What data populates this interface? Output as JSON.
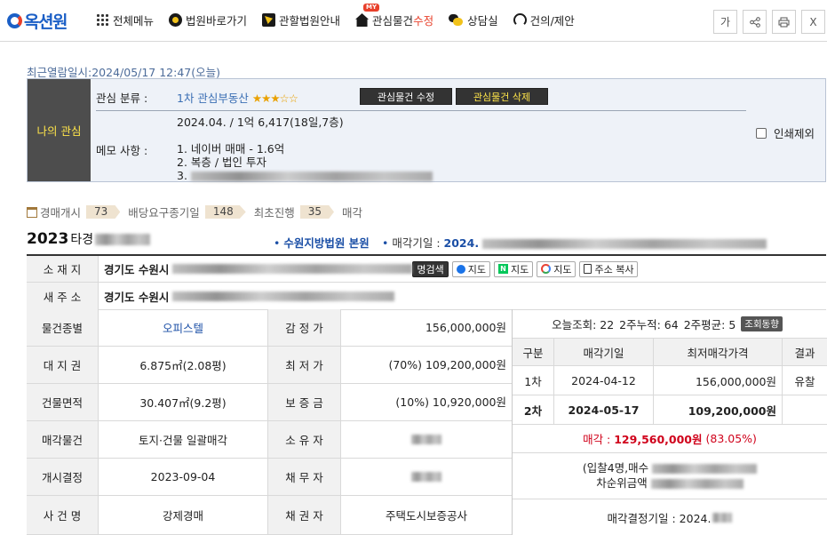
{
  "header": {
    "logo_text": "옥션원",
    "nav": [
      {
        "id": "all-menu",
        "label": "전체메뉴",
        "icon": "grid-icon"
      },
      {
        "id": "court-shortcut",
        "label": "법원바로가기",
        "icon": "gavel-icon"
      },
      {
        "id": "court-guide",
        "label": "관할법원안내",
        "icon": "map-icon"
      },
      {
        "id": "interest",
        "label_main": "관심물건",
        "label_accent": "수정",
        "badge": "MY",
        "icon": "house-icon"
      },
      {
        "id": "consult",
        "label": "상담실",
        "icon": "chat-icon"
      },
      {
        "id": "suggest",
        "label": "건의/제안",
        "icon": "headset-icon"
      }
    ],
    "buttons": {
      "font": "가",
      "share": "⋖",
      "print": "🖶",
      "close": "X"
    }
  },
  "recent_view": "최근열람일시:2024/05/17 12:47(오늘)",
  "my_interest": {
    "label": "나의 관심",
    "class_label": "관심 분류 :",
    "class_value": "1차 관심부동산",
    "stars": "★★★☆☆",
    "edit_button": "관심물건 수정",
    "delete_button": "관심물건 삭제",
    "memo_label": "메모 사항 :",
    "memo_lines": [
      "2024.04. / 1억 6,417(18일,7층)",
      "",
      "1. 네이버 매매 - 1.6억",
      "2. 복층 / 법인 투자",
      "3."
    ],
    "print_exclude": "인쇄제외"
  },
  "progress": [
    {
      "label": "경매개시",
      "count": "73"
    },
    {
      "label": "배당요구종기일",
      "count": "148"
    },
    {
      "label": "최초진행",
      "count": "35"
    },
    {
      "label": "매각",
      "count": ""
    }
  ],
  "case": {
    "number": "2023",
    "type": "타경",
    "court": "수원지방법원 본원",
    "due_label": "매각기일 :",
    "due_value": "2024."
  },
  "address": {
    "label": "소 재 지",
    "value": "경기도 수원시",
    "map_search": "명검색",
    "daum": "지도",
    "naver": "지도",
    "google": "지도",
    "copy": "주소 복사"
  },
  "new_address": {
    "label": "새 주 소",
    "value": "경기도 수원시"
  },
  "grid": [
    {
      "h1": "물건종별",
      "v1": "오피스텔",
      "h2": "감 정 가",
      "v2": "156,000,000원"
    },
    {
      "h1": "대 지 권",
      "v1": "6.875㎡(2.08평)",
      "h2": "최 저 가",
      "v2": "(70%) 109,200,000원"
    },
    {
      "h1": "건물면적",
      "v1": "30.407㎡(9.2평)",
      "h2": "보 증 금",
      "v2": "(10%) 10,920,000원"
    },
    {
      "h1": "매각물건",
      "v1": "토지·건물 일괄매각",
      "h2": "소 유 자",
      "v2": ""
    },
    {
      "h1": "개시결정",
      "v1": "2023-09-04",
      "h2": "채 무 자",
      "v2": ""
    },
    {
      "h1": "사 건 명",
      "v1": "강제경매",
      "h2": "채 권 자",
      "v2": "주택도시보증공사"
    }
  ],
  "stats": {
    "today": "오늘조회: 22",
    "cumulative": "2주누적: 64",
    "avg": "2주평균: 5",
    "trend_button": "조회동향"
  },
  "bids": {
    "headers": [
      "구분",
      "매각기일",
      "최저매각가격",
      "결과"
    ],
    "rows": [
      {
        "round": "1차",
        "date": "2024-04-12",
        "price": "156,000,000원",
        "result": "유찰"
      },
      {
        "round": "2차",
        "date": "2024-05-17",
        "price": "109,200,000원",
        "result": ""
      }
    ]
  },
  "sale": {
    "label": "매각 :",
    "price": "129,560,000원",
    "ratio": "(83.05%)"
  },
  "bidders": {
    "line1": "(입찰4명,매수",
    "line2": "차순위금액"
  },
  "decision": "매각결정기일 : 2024."
}
